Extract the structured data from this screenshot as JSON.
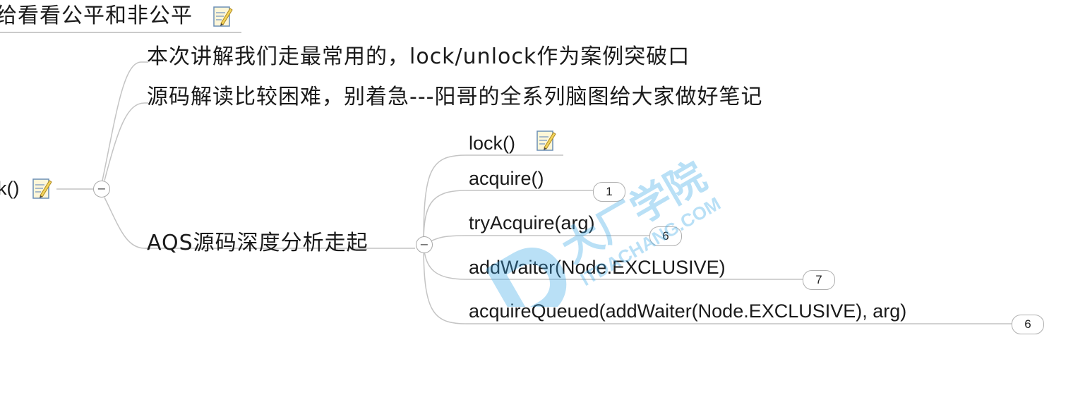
{
  "topic": {
    "title": "给看看公平和非公平",
    "root_label": "k()"
  },
  "branches": {
    "b1": "本次讲解我们走最常用的，lock/unlock作为案例突破口",
    "b2": "源码解读比较困难，别着急---阳哥的全系列脑图给大家做好笔记",
    "b3": "AQS源码深度分析走起"
  },
  "aqs_children": [
    {
      "label": "lock()"
    },
    {
      "label": "acquire()",
      "badge": "1"
    },
    {
      "label": "tryAcquire(arg)",
      "badge": "6"
    },
    {
      "label": "addWaiter(Node.EXCLUSIVE)",
      "badge": "7"
    },
    {
      "label": "acquireQueued(addWaiter(Node.EXCLUSIVE), arg)",
      "badge": "6"
    }
  ],
  "collapse_symbol": "−",
  "icons": {
    "note": "note-pencil-icon",
    "collapse": "minus-icon"
  },
  "watermark": {
    "text_cn": "大厂学院",
    "text_en": "ITDACHANG.COM",
    "color": "#3aa8e8"
  },
  "colors": {
    "line": "#c4c4c4",
    "text": "#1a1a1a",
    "note_yellow": "#f2d45c",
    "note_blue": "#6b8fb5"
  }
}
